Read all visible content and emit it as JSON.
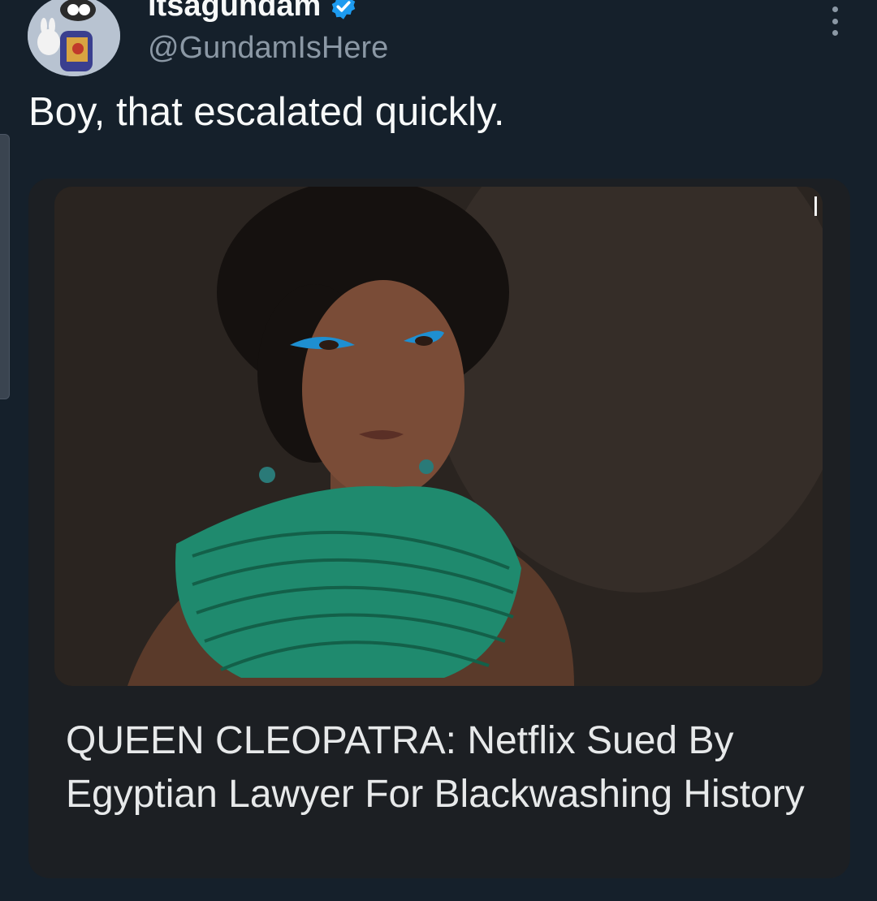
{
  "tweet": {
    "display_name": "itsagundam",
    "handle": "@GundamIsHere",
    "text": "Boy, that escalated quickly.",
    "verified_icon": "verified-badge-icon",
    "more_icon": "more-options-icon"
  },
  "card": {
    "headline": "QUEEN CLEOPATRA: Netflix Sued By Egyptian Lawyer For Blackwashing History",
    "image_icon": "photo-portrait"
  },
  "colors": {
    "background": "#15202b",
    "card_background": "#1c1f23",
    "verified": "#1d9bf0",
    "secondary_text": "#8b98a5"
  }
}
